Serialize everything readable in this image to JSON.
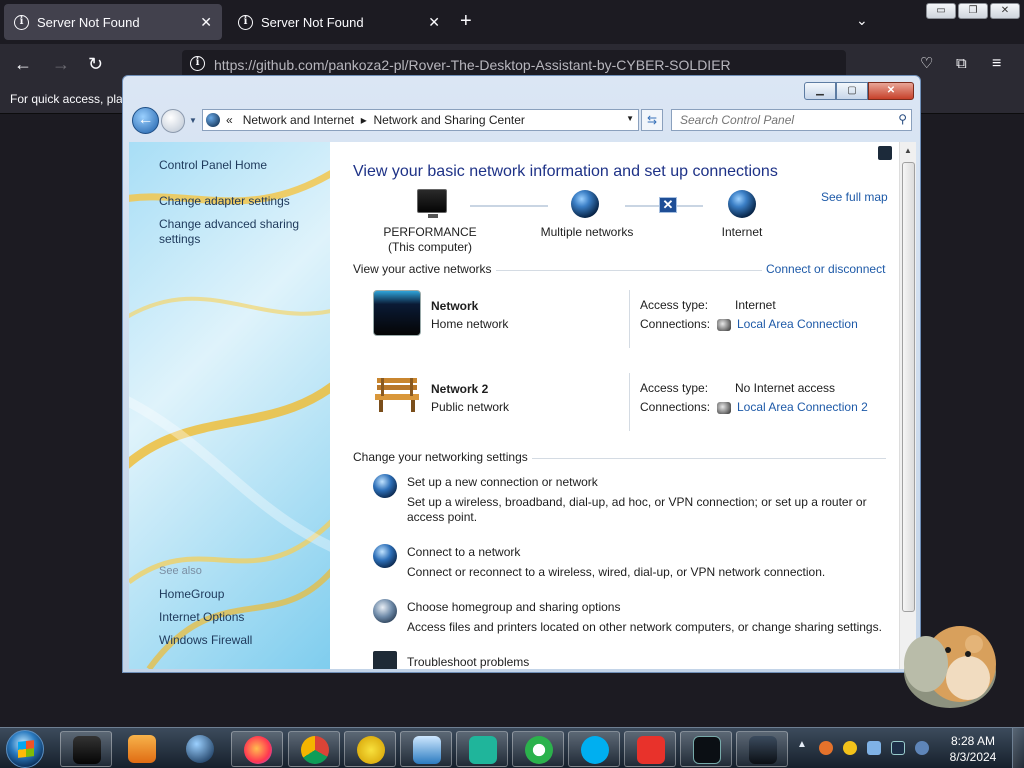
{
  "browser": {
    "tabs": [
      {
        "title": "Server Not Found",
        "active": true
      },
      {
        "title": "Server Not Found",
        "active": false
      }
    ],
    "url": "https://github.com/pankoza2-pl/Rover-The-Desktop-Assistant-by-CYBER-SOLDIER",
    "bookmarks_hint": "For quick access, plac"
  },
  "window": {
    "breadcrumb": [
      "Network and Internet",
      "Network and Sharing Center"
    ],
    "breadcrumb_prefix": "«",
    "search_placeholder": "Search Control Panel",
    "sidebar": {
      "links": [
        "Control Panel Home",
        "Change adapter settings",
        "Change advanced sharing settings"
      ],
      "see_also_label": "See also",
      "see_also": [
        "HomeGroup",
        "Internet Options",
        "Windows Firewall"
      ]
    },
    "main": {
      "title": "View your basic network information and set up connections",
      "see_full_map": "See full map",
      "map": {
        "computer": "PERFORMANCE",
        "computer_sub": "(This computer)",
        "middle": "Multiple networks",
        "internet": "Internet"
      },
      "active_networks_label": "View your active networks",
      "connect_disconnect": "Connect or disconnect",
      "networks": [
        {
          "name": "Network",
          "type": "Home network",
          "access_label": "Access type:",
          "access": "Internet",
          "conn_label": "Connections:",
          "connection": "Local Area Connection"
        },
        {
          "name": "Network  2",
          "type": "Public network",
          "access_label": "Access type:",
          "access": "No Internet access",
          "conn_label": "Connections:",
          "connection": "Local Area Connection 2"
        }
      ],
      "change_settings_label": "Change your networking settings",
      "tasks": [
        {
          "title": "Set up a new connection or network",
          "desc": "Set up a wireless, broadband, dial-up, ad hoc, or VPN connection; or set up a router or",
          "desc2": "access point."
        },
        {
          "title": "Connect to a network",
          "desc": "Connect or reconnect to a wireless, wired, dial-up, or VPN network connection.",
          "desc2": ""
        },
        {
          "title": "Choose homegroup and sharing options",
          "desc": "Access files and printers located on other network computers, or change sharing settings.",
          "desc2": ""
        },
        {
          "title": "Troubleshoot problems",
          "desc": "",
          "desc2": ""
        }
      ]
    }
  },
  "taskbar": {
    "time": "8:28 AM",
    "date": "8/3/2024"
  },
  "colors": {
    "link": "#1e5aa8",
    "title": "#1e3287",
    "browser_bg": "#1c1b22"
  }
}
